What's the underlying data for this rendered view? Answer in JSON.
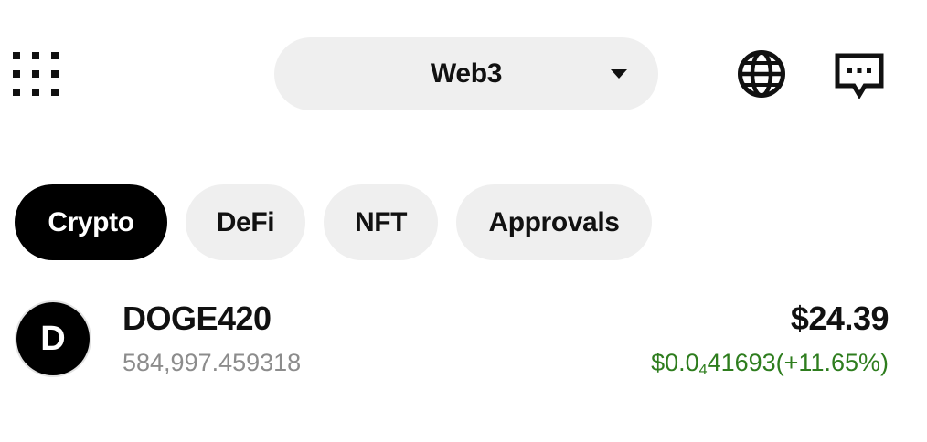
{
  "header": {
    "apps_icon": "grid-dots-icon",
    "network": {
      "label": "Web3",
      "caret_icon": "caret-down-icon"
    },
    "globe_icon": "globe-icon",
    "chat_icon": "chat-bubble-icon"
  },
  "tabs": [
    {
      "label": "Crypto",
      "active": true
    },
    {
      "label": "DeFi",
      "active": false
    },
    {
      "label": "NFT",
      "active": false
    },
    {
      "label": "Approvals",
      "active": false
    }
  ],
  "tokens": [
    {
      "avatar_letter": "D",
      "name": "DOGE420",
      "balance": "584,997.459318",
      "value": "$24.39",
      "price_prefix": "$0.0",
      "price_zero_count": "4",
      "price_digits": "41693",
      "price_change": "(+11.65%)"
    }
  ],
  "colors": {
    "accent": "#000000",
    "pill_bg": "#efefef",
    "positive": "#2e7d1e",
    "muted_text": "#8c8c8c"
  }
}
